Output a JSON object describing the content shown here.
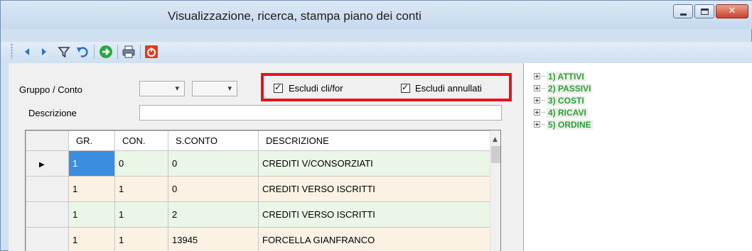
{
  "window": {
    "title": "Visualizzazione, ricerca, stampa piano dei conti",
    "controls": {
      "minimize": "minimize",
      "maximize": "maximize",
      "close": "✕"
    }
  },
  "toolbar": {
    "icons": [
      "arrow-left-icon",
      "arrow-right-icon",
      "filter-icon",
      "undo-icon",
      "go-icon",
      "print-icon",
      "power-icon"
    ]
  },
  "filters": {
    "group_label": "Gruppo / Conto",
    "description_label": "Descrizione",
    "group_value": "",
    "account_value": "",
    "description_value": "",
    "exclude_clients_label": "Escludi cli/for",
    "exclude_clients_checked": true,
    "exclude_cancelled_label": "Escludi annullati",
    "exclude_cancelled_checked": true,
    "highlight_color": "#e4141d"
  },
  "grid": {
    "columns": [
      "GR.",
      "CON.",
      "S.CONTO",
      "DESCRIZIONE"
    ],
    "rows": [
      {
        "gr": "1",
        "con": "0",
        "sconto": "0",
        "descrizione": "CREDITI V/CONSORZIATI",
        "current": true
      },
      {
        "gr": "1",
        "con": "1",
        "sconto": "0",
        "descrizione": "CREDITI VERSO ISCRITTI",
        "current": false
      },
      {
        "gr": "1",
        "con": "1",
        "sconto": "2",
        "descrizione": "CREDITI VERSO ISCRITTI",
        "current": false
      },
      {
        "gr": "1",
        "con": "1",
        "sconto": "13945",
        "descrizione": "FORCELLA GIANFRANCO",
        "current": false
      }
    ],
    "row_colors": {
      "green": "#eaf6e6",
      "beige": "#fbf2e4",
      "selected": "#3b8de0"
    }
  },
  "tree": {
    "items": [
      "1) ATTIVI",
      "2) PASSIVI",
      "3) COSTI",
      "4) RICAVI",
      "5) ORDINE"
    ],
    "color": "#2b9e3b"
  }
}
